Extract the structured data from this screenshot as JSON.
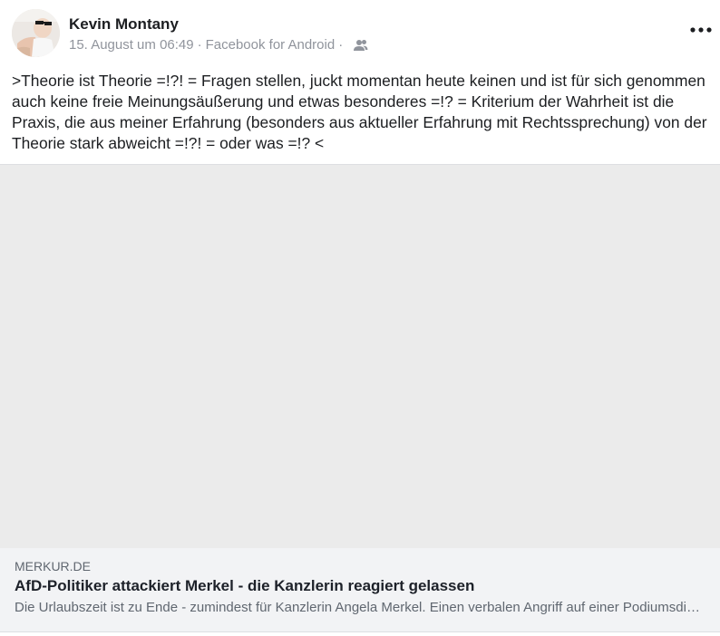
{
  "post": {
    "author": "Kevin Montany",
    "date": "15. August um 06:49",
    "separator": "·",
    "source": "Facebook for Android",
    "audience_icon": "friends-icon",
    "more_icon": "ellipsis-icon",
    "text": ">Theorie ist Theorie =!?! = Fragen stellen, juckt momentan heute keinen und ist für sich genommen auch keine freie Meinungsäußerung und etwas besonderes =!? = Kriterium der Wahrheit ist die Praxis, die aus meiner Erfahrung (besonders aus aktueller Erfahrung mit Rechtssprechung) von der Theorie stark abweicht =!?! = oder was =!? <"
  },
  "link": {
    "domain": "MERKUR.DE",
    "title": "AfD-Politiker attackiert Merkel - die Kanzlerin reagiert gelassen",
    "description": "Die Urlaubszeit ist zu Ende - zumindest für Kanzlerin Angela Merkel. Einen verbalen Angriff auf einer Podiumsdiskussion"
  },
  "colors": {
    "text_primary": "#1c1e21",
    "text_secondary": "#90949c",
    "card_bg": "#f2f3f5",
    "image_placeholder": "#ebebeb"
  }
}
